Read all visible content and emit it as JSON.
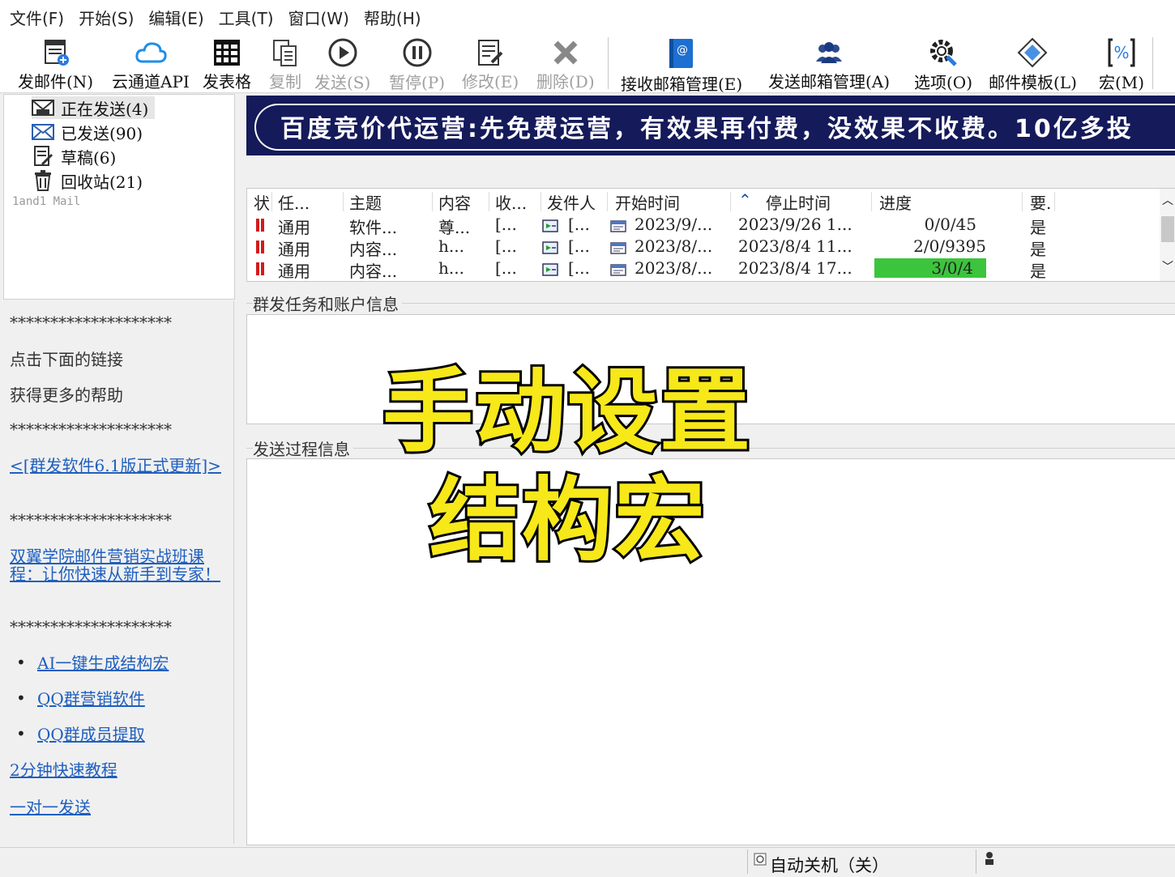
{
  "menu": [
    "文件(F)",
    "开始(S)",
    "编辑(E)",
    "工具(T)",
    "窗口(W)",
    "帮助(H)"
  ],
  "toolbar": [
    {
      "label": "发邮件(N)",
      "icon": "new-mail-icon",
      "enabled": true
    },
    {
      "label": "云通道API",
      "icon": "cloud-icon",
      "enabled": true
    },
    {
      "label": "发表格",
      "icon": "table-icon",
      "enabled": true
    },
    {
      "label": "复制",
      "icon": "copy-icon",
      "enabled": false
    },
    {
      "label": "发送(S)",
      "icon": "play-icon",
      "enabled": false
    },
    {
      "label": "暂停(P)",
      "icon": "pause-icon",
      "enabled": false
    },
    {
      "label": "修改(E)",
      "icon": "edit-icon",
      "enabled": false
    },
    {
      "label": "删除(D)",
      "icon": "delete-icon",
      "enabled": false
    },
    {
      "label": "接收邮箱管理(E)",
      "icon": "address-book-icon",
      "enabled": true
    },
    {
      "label": "发送邮箱管理(A)",
      "icon": "users-icon",
      "enabled": true
    },
    {
      "label": "选项(O)",
      "icon": "gear-icon",
      "enabled": true
    },
    {
      "label": "邮件模板(L)",
      "icon": "template-icon",
      "enabled": true
    },
    {
      "label": "宏(M)",
      "icon": "macro-icon",
      "enabled": true
    }
  ],
  "folders": [
    {
      "label": "正在发送(4)",
      "icon": "outbox-icon",
      "selected": true
    },
    {
      "label": "已发送(90)",
      "icon": "mail-icon",
      "selected": false
    },
    {
      "label": "草稿(6)",
      "icon": "draft-icon",
      "selected": false
    },
    {
      "label": "回收站(21)",
      "icon": "trash-icon",
      "selected": false
    }
  ],
  "app_name": "1and1 Mail",
  "help": {
    "separator": "********************",
    "line1": "点击下面的链接",
    "line2": "获得更多的帮助",
    "link_update": "<[群发软件6.1版正式更新]>",
    "link_course": "双翼学院邮件营销实战班课程：让你快速从新手到专家！",
    "bullets": [
      "AI一键生成结构宏",
      "QQ群营销软件",
      "QQ群成员提取"
    ],
    "link_tutorial": "2分钟快速教程",
    "link_one2one": "一对一发送"
  },
  "banner": "百度竞价代运营:先免费运营，有效果再付费，没效果不收费。10亿多投",
  "task_table": {
    "columns": [
      "状",
      "任...",
      "主题",
      "内容",
      "收...",
      "发件人",
      "开始时间",
      "停止时间",
      "进度",
      "要."
    ],
    "rows": [
      {
        "task": "通用",
        "subject": "软件...",
        "content": "尊...",
        "recv": "[...",
        "sender": "[...",
        "start": "2023/9/...",
        "stop": "2023/9/26 1...",
        "progress": "0/0/45",
        "progress_pct": 0,
        "req": "是"
      },
      {
        "task": "通用",
        "subject": "内容...",
        "content": "h...",
        "recv": "[...",
        "sender": "[...",
        "start": "2023/8/...",
        "stop": "2023/8/4 11...",
        "progress": "2/0/9395",
        "progress_pct": 0,
        "req": "是"
      },
      {
        "task": "通用",
        "subject": "内容...",
        "content": "h...",
        "recv": "[...",
        "sender": "[...",
        "start": "2023/8/...",
        "stop": "2023/8/4 17...",
        "progress": "3/0/4",
        "progress_pct": 100,
        "req": "是"
      }
    ]
  },
  "group_info_title": "群发任务和账户信息",
  "group_process_title": "发送过程信息",
  "overlay": {
    "line1": "手动设置",
    "line2": "结构宏"
  },
  "status": {
    "auto_shutdown": "自动关机（关）"
  },
  "colors": {
    "banner_bg": "#141a5a",
    "progress_fill": "#3cc43c",
    "pause_red": "#d41a1a",
    "link": "#1f5fbf",
    "caption": "#f7e81a"
  }
}
